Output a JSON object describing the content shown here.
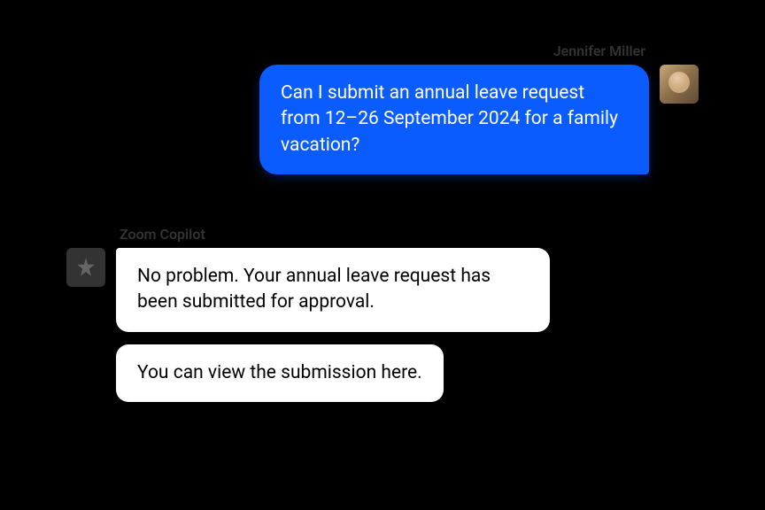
{
  "user": {
    "name": "Jennifer Miller",
    "message": "Can I submit an annual leave request from 12–26 September 2024 for a family vacation?"
  },
  "bot": {
    "name": "Zoom Copilot",
    "messages": [
      "No problem. Your annual leave request has been submitted for approval.",
      "You can view the submission here."
    ]
  }
}
